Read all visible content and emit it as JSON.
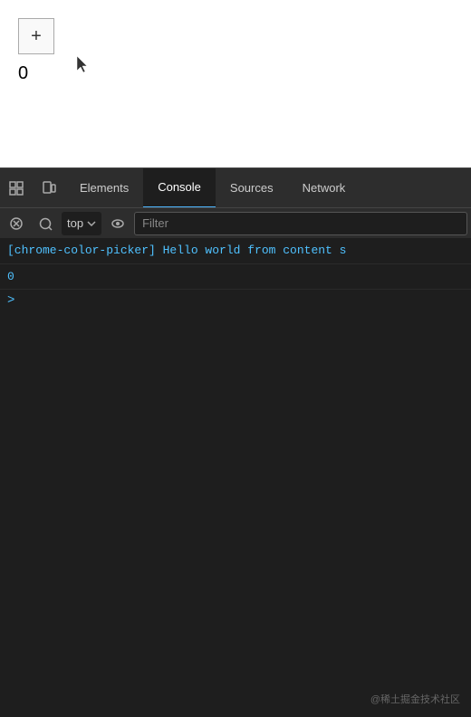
{
  "viewport": {
    "counter_button_label": "+",
    "counter_value": "0"
  },
  "devtools": {
    "tab_bar": {
      "tabs": [
        {
          "id": "elements",
          "label": "Elements",
          "active": false
        },
        {
          "id": "console",
          "label": "Console",
          "active": true
        },
        {
          "id": "sources",
          "label": "Sources",
          "active": false
        },
        {
          "id": "network",
          "label": "Network",
          "active": false
        }
      ]
    },
    "toolbar": {
      "context_label": "top",
      "filter_placeholder": "Filter"
    },
    "console_lines": [
      {
        "type": "log",
        "text": "[chrome-color-picker] Hello world from content s"
      },
      {
        "type": "value",
        "text": "0"
      }
    ],
    "prompt": ">"
  },
  "watermark": {
    "text": "@稀土掘金技术社区"
  }
}
